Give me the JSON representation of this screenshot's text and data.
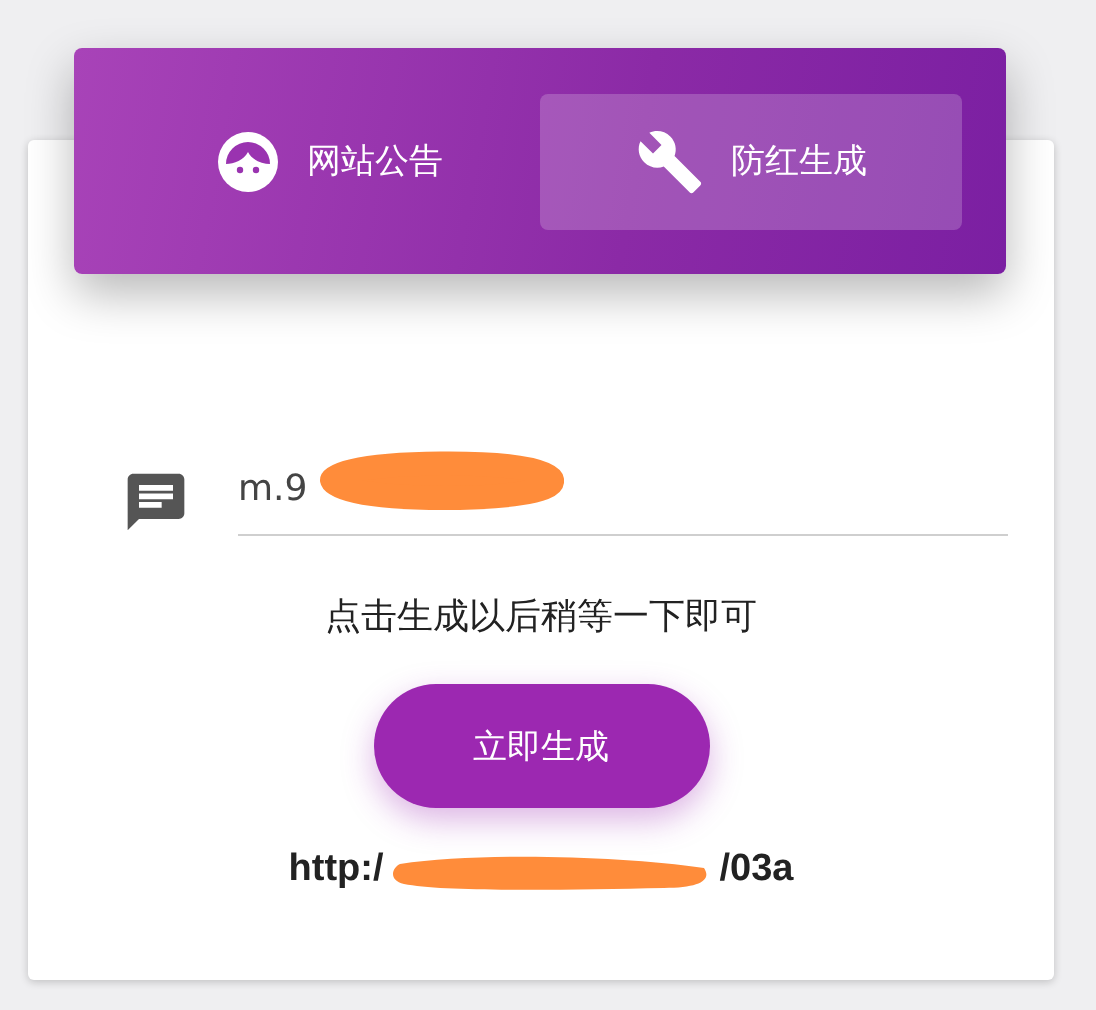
{
  "tabs": [
    {
      "label": "网站公告",
      "selected": false
    },
    {
      "label": "防红生成",
      "selected": true
    }
  ],
  "field": {
    "value": "m.9"
  },
  "hint": "点击生成以后稍等一下即可",
  "button": "立即生成",
  "result": {
    "start": "http:/",
    "end": "/03a"
  }
}
